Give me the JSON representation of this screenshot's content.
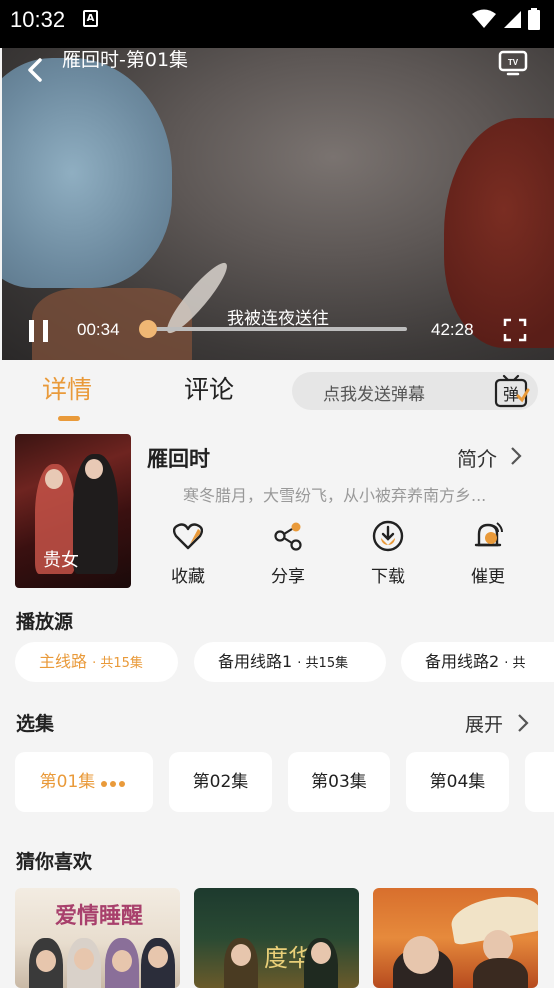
{
  "status_bar": {
    "time": "10:32",
    "notification_icon": "A"
  },
  "player": {
    "title": "雁回时-第01集",
    "subtitle": "我被连夜送往",
    "current_time": "00:34",
    "total_time": "42:28",
    "progress_fraction": 0.013
  },
  "tabs": [
    {
      "label": "详情"
    },
    {
      "label": "评论"
    }
  ],
  "danmu": {
    "placeholder": "点我发送弹幕",
    "icon_label": "弹"
  },
  "show": {
    "poster_title": "贵女",
    "title": "雁回时",
    "intro_label": "简介",
    "description": "寒冬腊月，大雪纷飞，从小被弃养南方乡..."
  },
  "actions": [
    {
      "label": "收藏",
      "icon": "heart-icon"
    },
    {
      "label": "分享",
      "icon": "share-icon"
    },
    {
      "label": "下载",
      "icon": "download-icon"
    },
    {
      "label": "催更",
      "icon": "bell-icon"
    }
  ],
  "sources": {
    "title": "播放源",
    "items": [
      {
        "name": "主线路",
        "count": "· 共15集"
      },
      {
        "name": "备用线路1",
        "count": "· 共15集"
      },
      {
        "name": "备用线路2",
        "count": "· 共"
      }
    ]
  },
  "episodes": {
    "title": "选集",
    "expand_label": "展开",
    "items": [
      "第01集",
      "第02集",
      "第03集",
      "第04集"
    ]
  },
  "recommend": {
    "title": "猜你喜欢",
    "items": [
      {
        "poster_text": "爱情睡醒"
      },
      {
        "poster_text": "度华"
      },
      {
        "poster_text": ""
      }
    ]
  },
  "colors": {
    "accent": "#e99a3a",
    "background": "#f4f4f4"
  }
}
